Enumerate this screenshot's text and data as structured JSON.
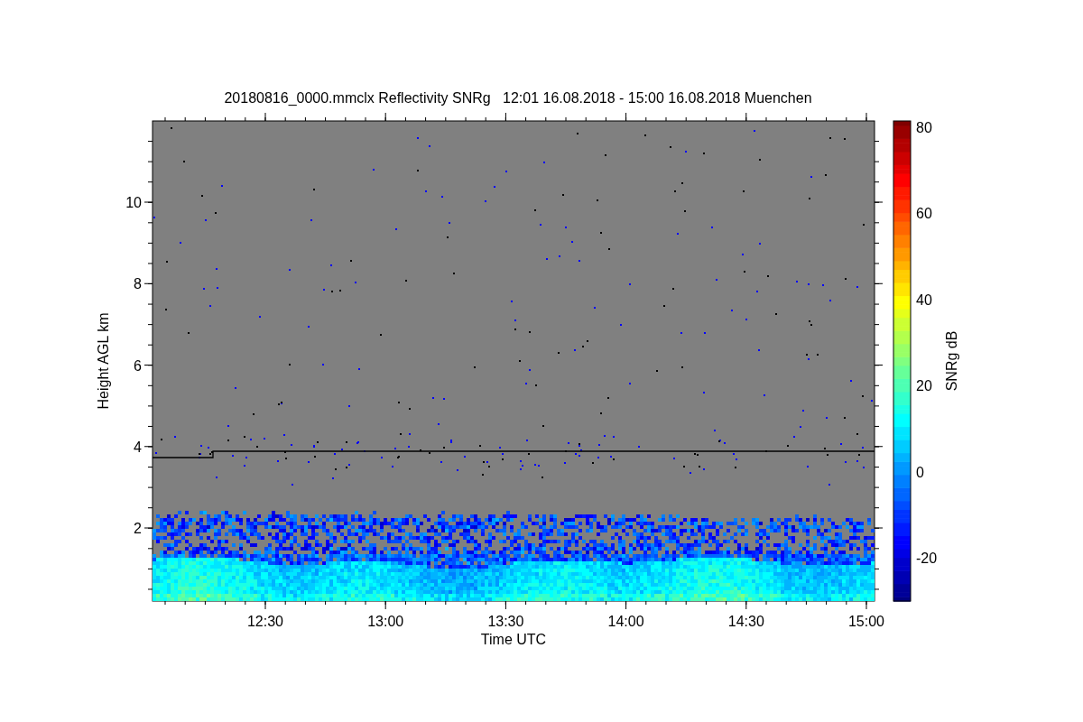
{
  "chart": {
    "title": "20180816_0000.mmclx Reflectivity SNRg   12:01 16.08.2018 - 15:00 16.08.2018 Muenchen",
    "ylabel": "Height AGL km",
    "yticks": [
      "10",
      "8",
      "6",
      "4",
      "2"
    ],
    "xlabel": "Time UTC",
    "xticks": [
      "12:30",
      "13:00",
      "13:30",
      "14:00",
      "14:30",
      "15:00"
    ]
  },
  "colorbar": {
    "label": "SNRg dB",
    "ticks": [
      "80",
      "60",
      "40",
      "20",
      "0",
      "-20"
    ]
  }
}
